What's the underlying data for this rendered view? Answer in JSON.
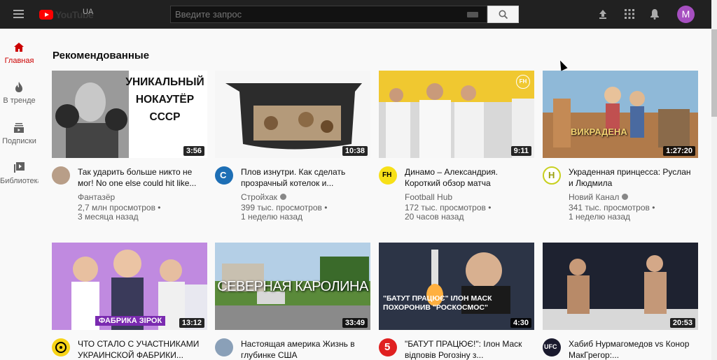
{
  "header": {
    "logo_text": "YouTube",
    "logo_region": "UA",
    "search_placeholder": "Введите запрос",
    "avatar_letter": "M"
  },
  "sidebar": {
    "items": [
      {
        "label": "Главная",
        "icon": "home-icon",
        "active": true
      },
      {
        "label": "В тренде",
        "icon": "trending-icon",
        "active": false
      },
      {
        "label": "Подписки",
        "icon": "subscriptions-icon",
        "active": false
      },
      {
        "label": "Библиотека",
        "icon": "library-icon",
        "active": false
      }
    ]
  },
  "main": {
    "section_title": "Рекомендованные",
    "videos": [
      {
        "title": "Так ударить больше никто не мог! No one else could hit like...",
        "channel": "Фантазёр",
        "views": "2,7 млн просмотров •",
        "age": "3 месяца назад",
        "duration": "3:56",
        "thumb_text": "УНИКАЛЬНЫЙ НОКАУТЁР СССР",
        "verified": false
      },
      {
        "title": "Плов изнутри. Как сделать прозрачный котелок и...",
        "channel": "Стройхак",
        "views": "399 тыс. просмотров •",
        "age": "1 неделю назад",
        "duration": "10:38",
        "thumb_text": "",
        "verified": true
      },
      {
        "title": "Динамо – Александрия. Короткий обзор матча",
        "channel": "Football Hub",
        "views": "172 тыс. просмотров •",
        "age": "20 часов назад",
        "duration": "9:11",
        "thumb_text": "FH",
        "verified": false
      },
      {
        "title": "Украденная принцесса: Руслан и Людмила",
        "channel": "Новий Канал",
        "views": "341 тыс. просмотров •",
        "age": "1 неделю назад",
        "duration": "1:27:20",
        "thumb_text": "ВИКРАДЕНА",
        "verified": true
      },
      {
        "title": "ЧТО СТАЛО С УЧАСТНИКАМИ УКРАИНСКОЙ ФАБРИКИ...",
        "channel": "",
        "views": "",
        "age": "",
        "duration": "13:12",
        "thumb_text": "ФАБРИКА ЗІРОК",
        "verified": false
      },
      {
        "title": "Настоящая америка Жизнь в глубинке США",
        "channel": "",
        "views": "",
        "age": "",
        "duration": "33:49",
        "thumb_text": "СЕВЕРНАЯ КАРОЛИНА",
        "verified": false
      },
      {
        "title": "\"БАТУТ ПРАЦЮЄ!\": Ілон Маск відповів Рогозіну з...",
        "channel": "",
        "views": "",
        "age": "",
        "duration": "4:30",
        "thumb_text": "\"БАТУТ ПРАЦЮЄ\" ІЛОН МАСК ПОХОРОНИВ \"РОСКОСМОС\"",
        "verified": false
      },
      {
        "title": "Хабиб Нурмагомедов vs Конор МакГрегор:...",
        "channel": "",
        "views": "",
        "age": "",
        "duration": "20:53",
        "thumb_text": "",
        "verified": false
      }
    ]
  },
  "colors": {
    "topbar": "#212121",
    "accent": "#cc0000",
    "avatar": "#a64fc0"
  }
}
